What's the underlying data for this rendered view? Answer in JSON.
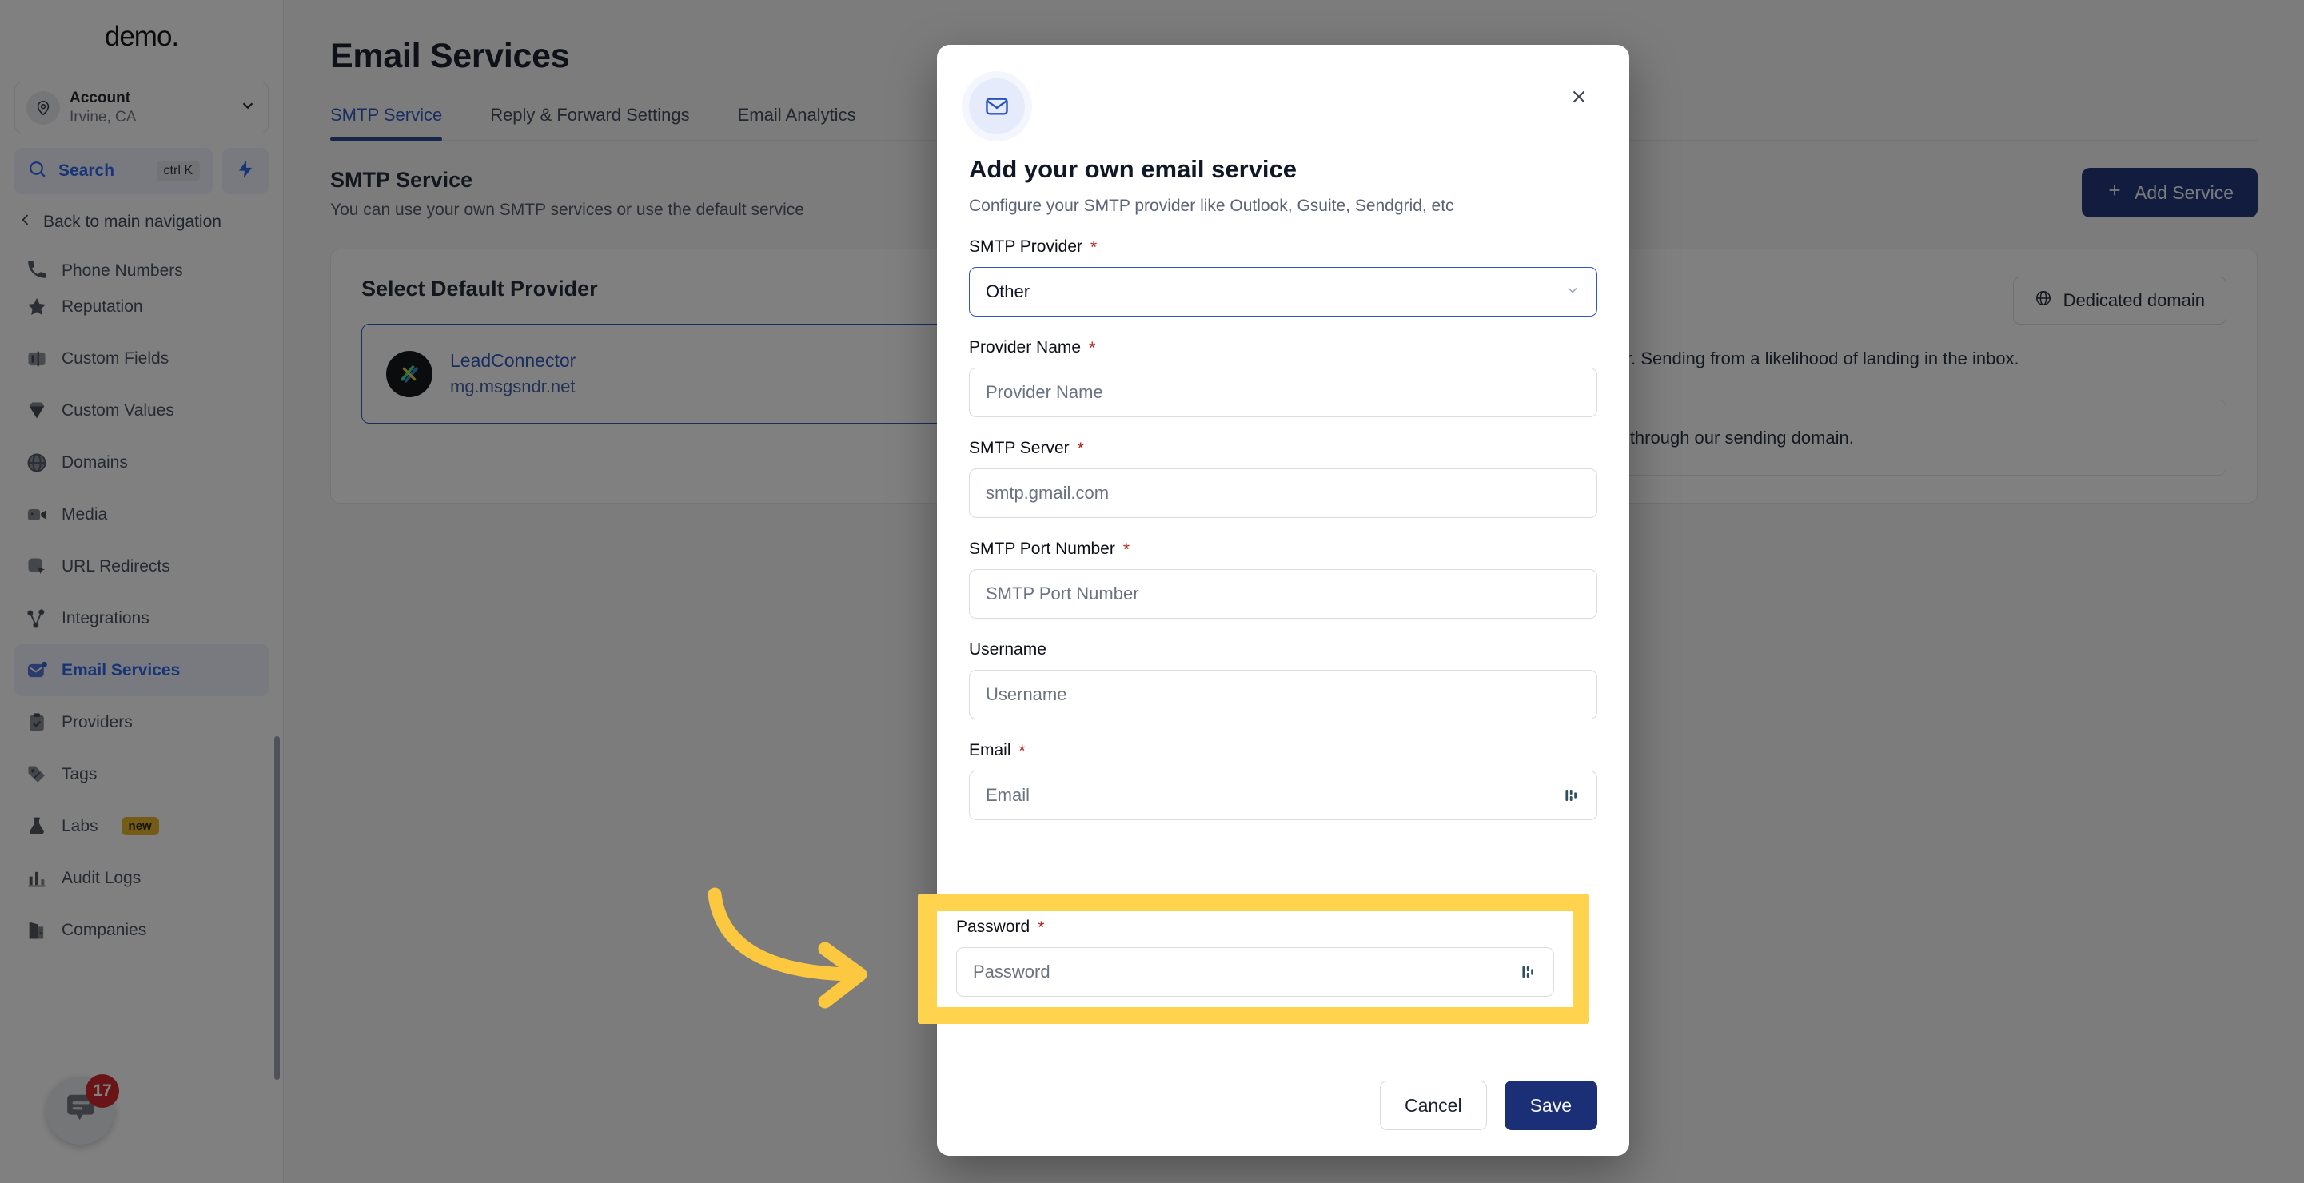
{
  "sidebar": {
    "brand": "demo.",
    "account": {
      "name": "Account",
      "location": "Irvine, CA",
      "avatar_icon": "location-pin-icon",
      "chevron_icon": "chevron-down-icon"
    },
    "search": {
      "label": "Search",
      "shortcut": "ctrl K",
      "icon": "search-icon",
      "bolt_icon": "bolt-icon"
    },
    "back_nav": {
      "label": "Back to main navigation",
      "icon": "chevron-left-icon"
    },
    "items": [
      {
        "label": "Phone Numbers",
        "icon": "phone-icon",
        "active": false
      },
      {
        "label": "Reputation",
        "icon": "star-icon",
        "active": false
      },
      {
        "label": "Custom Fields",
        "icon": "custom-fields-icon",
        "active": false
      },
      {
        "label": "Custom Values",
        "icon": "diamond-icon",
        "active": false
      },
      {
        "label": "Domains",
        "icon": "globe-icon",
        "active": false
      },
      {
        "label": "Media",
        "icon": "video-camera-icon",
        "active": false
      },
      {
        "label": "URL Redirects",
        "icon": "cursor-click-icon",
        "active": false
      },
      {
        "label": "Integrations",
        "icon": "share-nodes-icon",
        "active": false
      },
      {
        "label": "Email Services",
        "icon": "envelope-dot-icon",
        "active": true
      },
      {
        "label": "Providers",
        "icon": "clipboard-check-icon",
        "active": false
      },
      {
        "label": "Tags",
        "icon": "tag-icon",
        "active": false
      },
      {
        "label": "Labs",
        "icon": "flask-icon",
        "active": false,
        "badge": "new"
      },
      {
        "label": "Audit Logs",
        "icon": "bar-chart-icon",
        "active": false
      },
      {
        "label": "Companies",
        "icon": "building-icon",
        "active": false
      }
    ],
    "chat": {
      "icon": "chat-bubble-icon",
      "badge_count": "17"
    }
  },
  "main": {
    "page_title": "Email Services",
    "tabs": [
      {
        "label": "SMTP Service",
        "active": true
      },
      {
        "label": "Reply & Forward Settings",
        "active": false
      },
      {
        "label": "Email Analytics",
        "active": false
      }
    ],
    "section": {
      "title": "SMTP Service",
      "subtitle": "You can use your own SMTP services or use the default service"
    },
    "add_service_button": {
      "label": "Add Service",
      "icon": "plus-icon"
    },
    "left_panel": {
      "title": "Select Default Provider",
      "provider": {
        "name": "LeadConnector",
        "domain": "mg.msgsndr.net",
        "logo_icon": "leadconnector-logo-icon"
      }
    },
    "right_panel": {
      "dedicated_domain_button": {
        "label": "Dedicated domain",
        "icon": "globe-icon"
      },
      "body_text": "domain to use on LeadConnector. Sending from a likelihood of landing in the inbox.",
      "note_text": "p now, emails will be sending through our sending domain."
    }
  },
  "modal": {
    "header_icon": "envelope-icon",
    "close_icon": "close-icon",
    "title": "Add your own email service",
    "subtitle": "Configure your SMTP provider like Outlook, Gsuite, Sendgrid, etc",
    "fields": [
      {
        "label": "SMTP Provider",
        "required": true,
        "type": "select",
        "value": "Other",
        "placeholder": "",
        "caret_icon": "chevron-down-icon"
      },
      {
        "label": "Provider Name",
        "required": true,
        "type": "text",
        "value": "",
        "placeholder": "Provider Name"
      },
      {
        "label": "SMTP Server",
        "required": true,
        "type": "text",
        "value": "",
        "placeholder": "smtp.gmail.com"
      },
      {
        "label": "SMTP Port Number",
        "required": true,
        "type": "text",
        "value": "",
        "placeholder": "SMTP Port Number"
      },
      {
        "label": "Username",
        "required": false,
        "type": "text",
        "value": "",
        "placeholder": "Username"
      },
      {
        "label": "Email",
        "required": true,
        "type": "text",
        "value": "",
        "placeholder": "Email",
        "trailing_icon": "custom-values-icon"
      }
    ],
    "highlighted_field": {
      "label": "Password",
      "required": true,
      "placeholder": "Password",
      "trailing_icon": "custom-values-icon"
    },
    "footer": {
      "cancel_label": "Cancel",
      "save_label": "Save"
    }
  },
  "annotation": {
    "arrow_icon": "curved-arrow-right-icon",
    "arrow_color": "#FBC83F",
    "highlight_color": "#FFD34E"
  },
  "colors": {
    "accent_blue": "#2a52be",
    "primary_button": "#1b2f76",
    "required_red": "#b42318",
    "badge_red": "#cf2026",
    "badge_yellow": "#e8b422"
  }
}
